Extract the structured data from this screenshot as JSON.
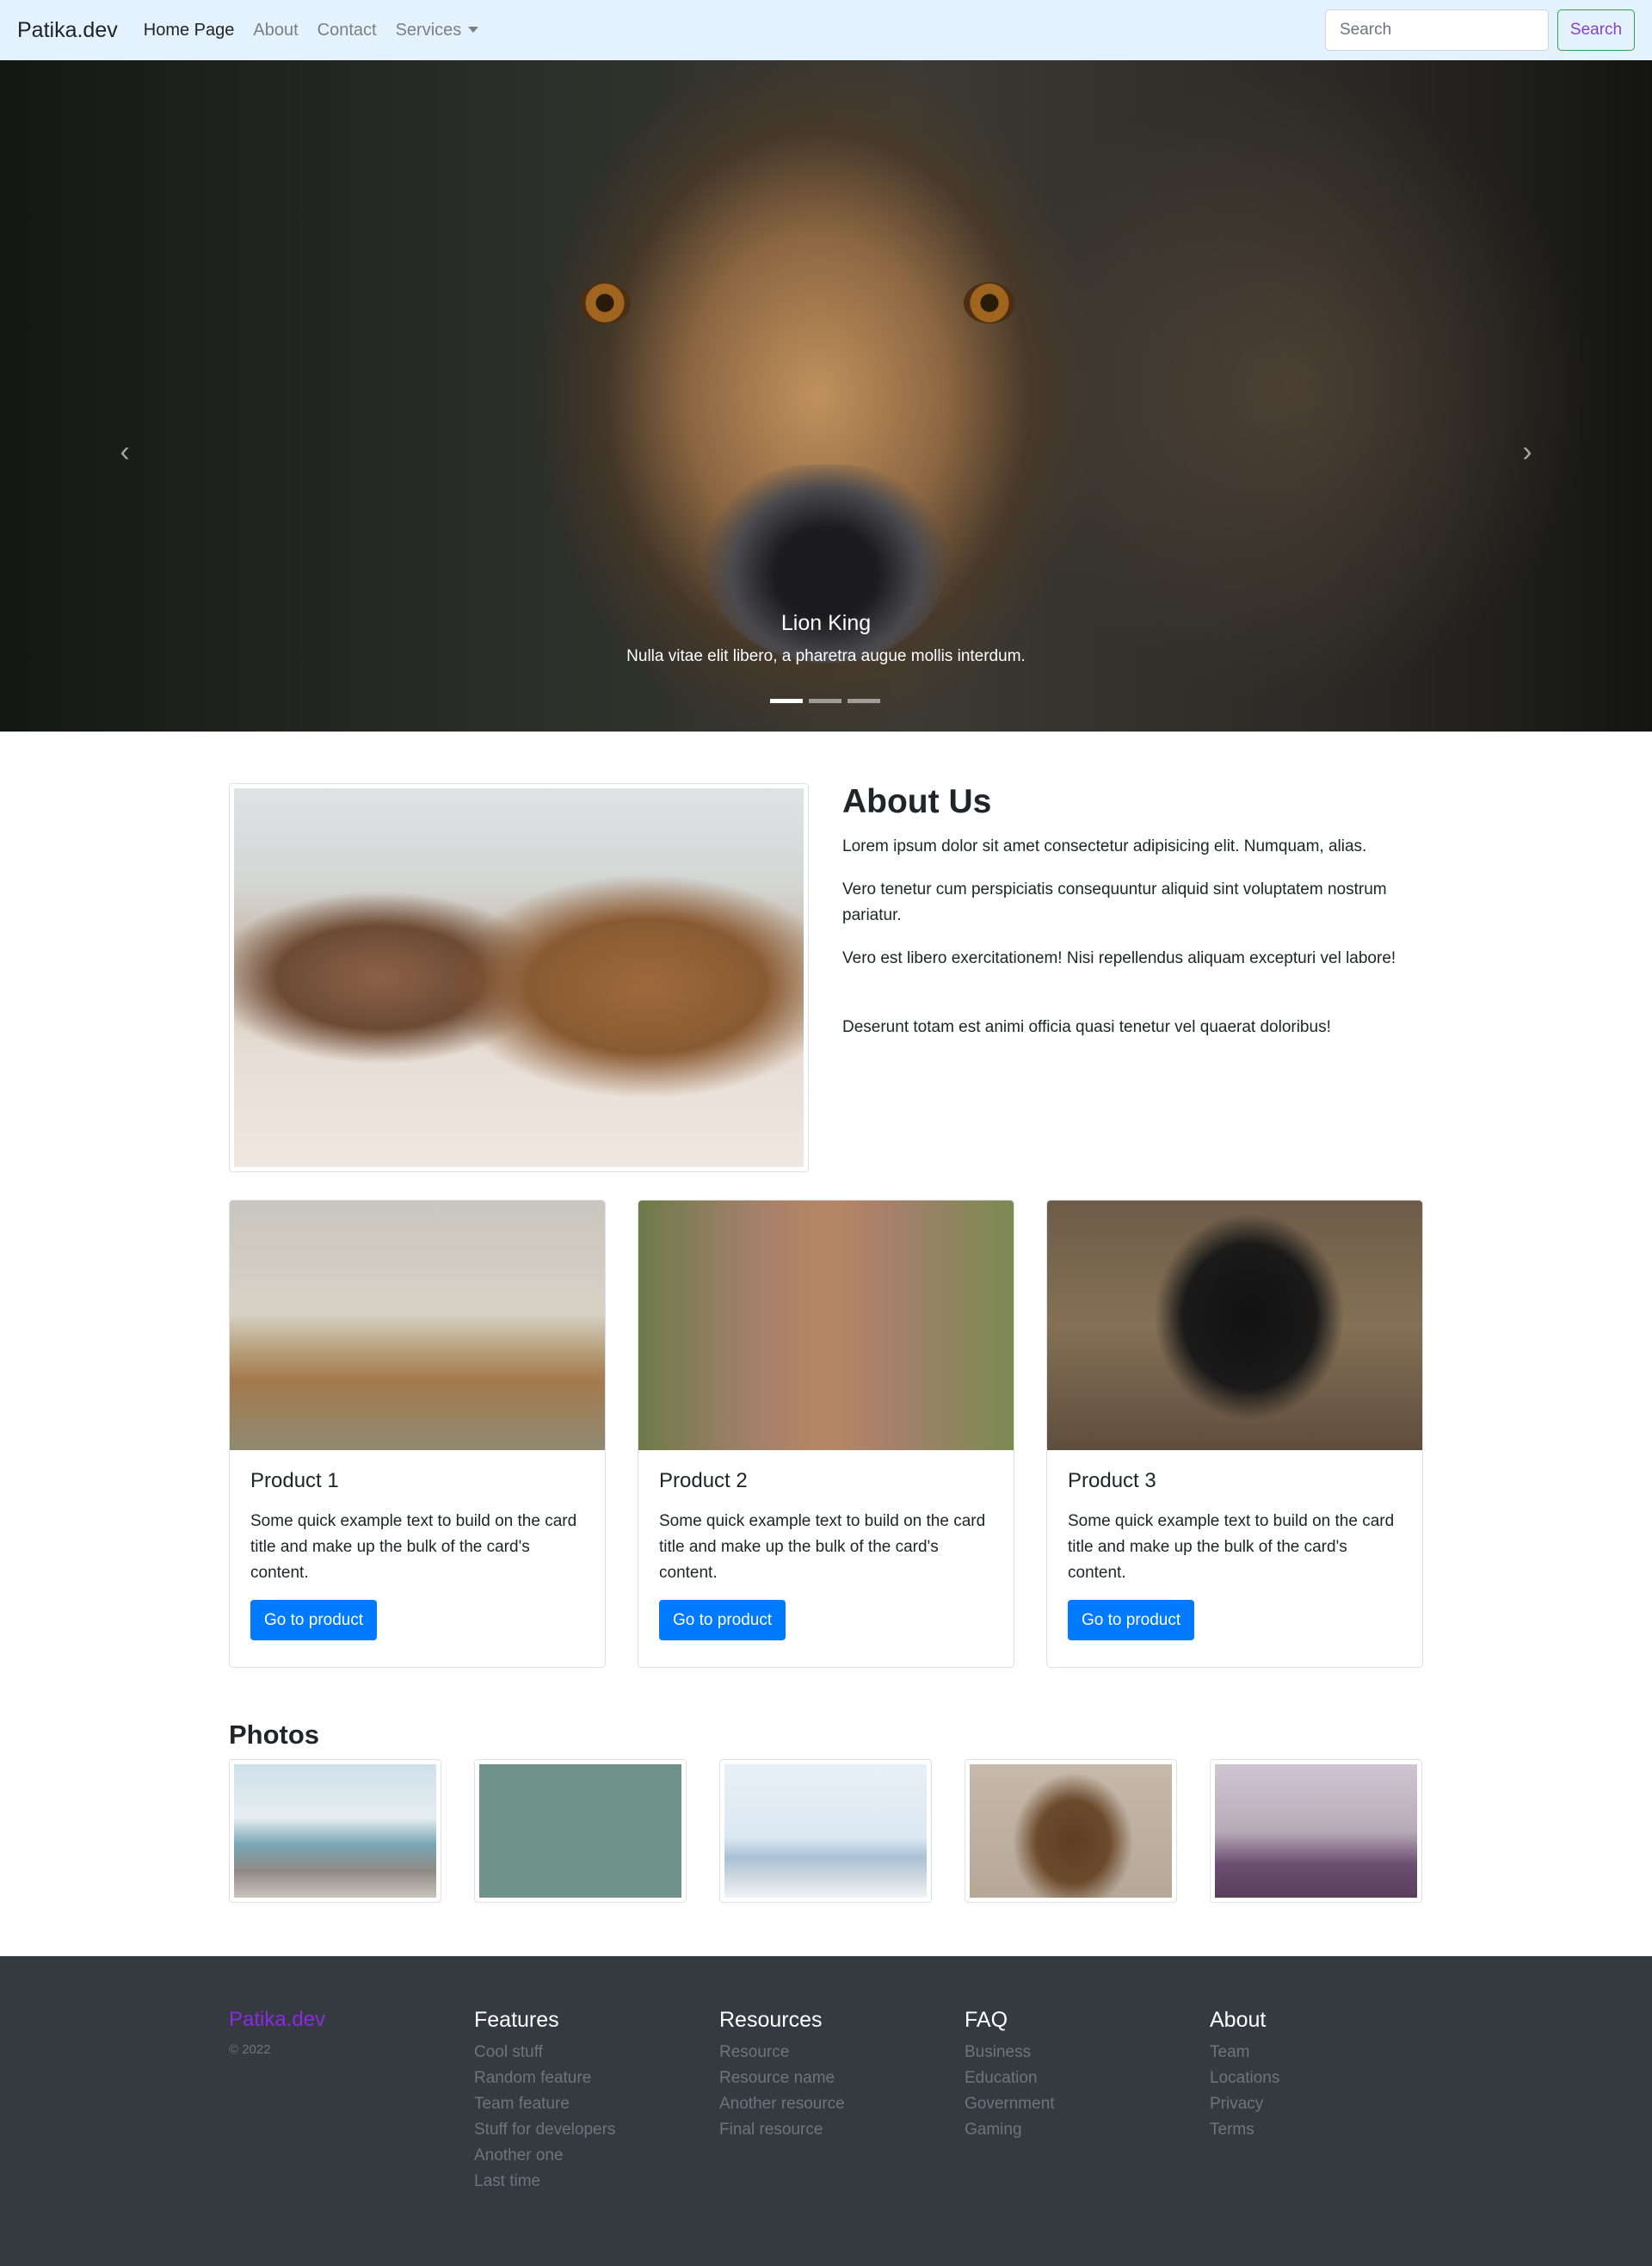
{
  "navbar": {
    "brand": "Patika.dev",
    "links": [
      {
        "label": "Home Page",
        "active": true
      },
      {
        "label": "About",
        "active": false
      },
      {
        "label": "Contact",
        "active": false
      },
      {
        "label": "Services",
        "active": false,
        "dropdown": true
      }
    ],
    "search_placeholder": "Search",
    "search_button": "Search"
  },
  "hero": {
    "caption_title": "Lion King",
    "caption_text": "Nulla vitae elit libero, a pharetra augue mollis interdum.",
    "prev_icon": "chevron-left-icon",
    "next_icon": "chevron-right-icon",
    "indicator_count": 3,
    "active_indicator": 1
  },
  "about": {
    "title": "About Us",
    "paragraphs": [
      "Lorem ipsum dolor sit amet consectetur adipisicing elit. Numquam, alias.",
      "Vero tenetur cum perspiciatis consequuntur aliquid sint voluptatem nostrum pariatur.",
      "Vero est libero exercitationem! Nisi repellendus aliquam excepturi vel labore!",
      "Deserunt totam est animi officia quasi tenetur vel quaerat doloribus!"
    ]
  },
  "cards": [
    {
      "title": "Product 1",
      "text": "Some quick example text to build on the card title and make up the bulk of the card's content.",
      "button": "Go to product"
    },
    {
      "title": "Product 2",
      "text": "Some quick example text to build on the card title and make up the bulk of the card's content.",
      "button": "Go to product"
    },
    {
      "title": "Product 3",
      "text": "Some quick example text to build on the card title and make up the bulk of the card's content.",
      "button": "Go to product"
    }
  ],
  "photos": {
    "title": "Photos"
  },
  "footer": {
    "brand": "Patika.dev",
    "copyright": "© 2022",
    "columns": [
      {
        "heading": "Features",
        "links": [
          "Cool stuff",
          "Random feature",
          "Team feature",
          "Stuff for developers",
          "Another one",
          "Last time"
        ]
      },
      {
        "heading": "Resources",
        "links": [
          "Resource",
          "Resource name",
          "Another resource",
          "Final resource"
        ]
      },
      {
        "heading": "FAQ",
        "links": [
          "Business",
          "Education",
          "Government",
          "Gaming"
        ]
      },
      {
        "heading": "About",
        "links": [
          "Team",
          "Locations",
          "Privacy",
          "Terms"
        ]
      }
    ]
  },
  "colors": {
    "navbar_bg": "#e3f2fd",
    "primary": "#007bff",
    "footer_bg": "#343a40",
    "brand_accent": "#8a2be2"
  }
}
